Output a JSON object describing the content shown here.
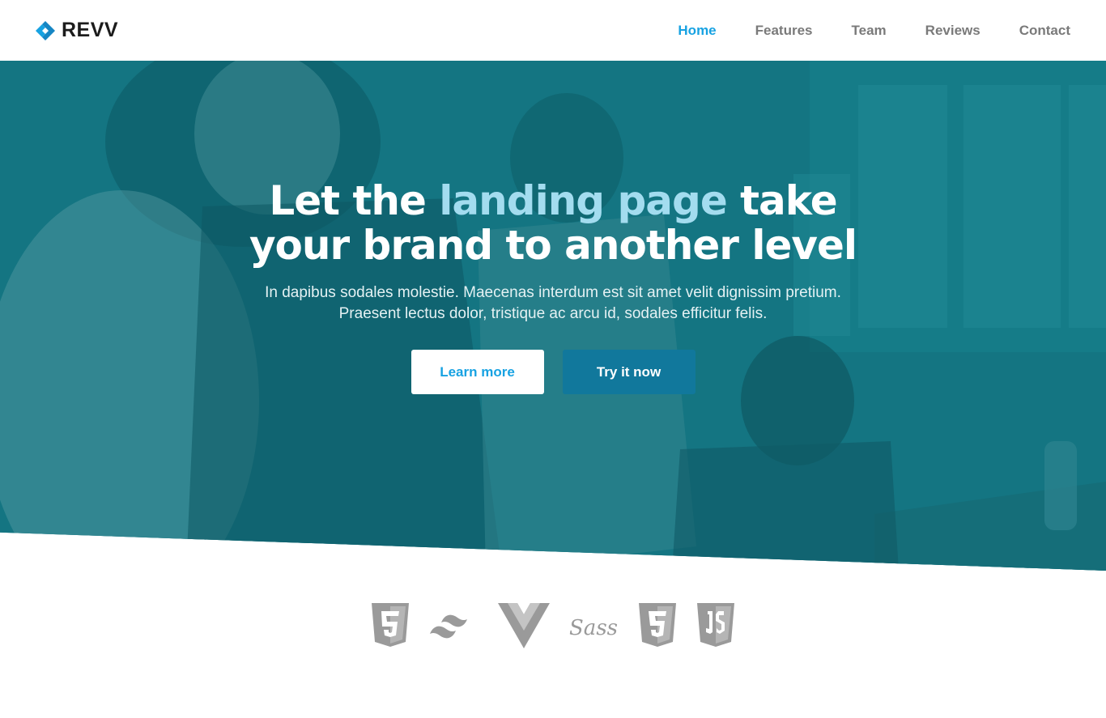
{
  "brand": {
    "name": "REVV",
    "accent": "#17a2e2"
  },
  "nav": {
    "items": [
      {
        "label": "Home",
        "active": true
      },
      {
        "label": "Features",
        "active": false
      },
      {
        "label": "Team",
        "active": false
      },
      {
        "label": "Reviews",
        "active": false
      },
      {
        "label": "Contact",
        "active": false
      }
    ]
  },
  "hero": {
    "headline_pre": "Let the ",
    "headline_highlight": "landing page",
    "headline_post": " take your brand to another level",
    "subtext_line1": "In dapibus sodales molestie. Maecenas interdum est sit amet velit dignissim pretium.",
    "subtext_line2": "Praesent lectus dolor, tristique ac arcu id, sodales efficitur felis.",
    "primary_button": "Learn more",
    "secondary_button": "Try it now",
    "overlay_color": "#167a86",
    "highlight_color": "#a3dcef"
  },
  "tech_logos": {
    "items": [
      {
        "icon": "html5-icon"
      },
      {
        "icon": "tailwind-icon"
      },
      {
        "icon": "vue-icon"
      },
      {
        "icon": "sass-icon",
        "label": "Sass"
      },
      {
        "icon": "css3-icon"
      },
      {
        "icon": "javascript-icon"
      }
    ]
  }
}
